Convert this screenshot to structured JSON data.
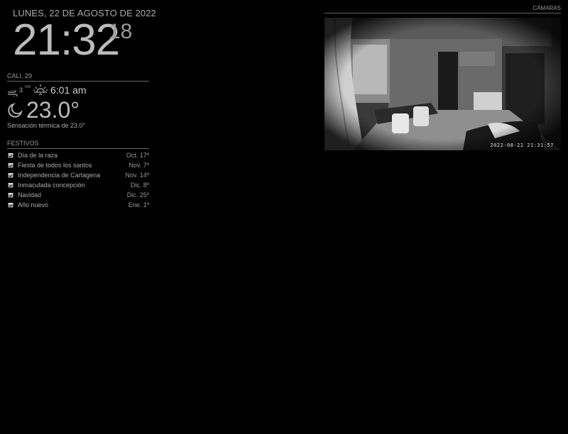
{
  "clock": {
    "date": "LUNES, 22 DE AGOSTO DE 2022",
    "hour_minute": "21:32",
    "seconds": "18"
  },
  "weather": {
    "header": "CALI, 29",
    "wind_speed": "3",
    "wind_direction": "NW",
    "sunrise": "6:01 am",
    "temperature": "23.0°",
    "feels_like": "Sensación térmica de 23.0°",
    "icons": {
      "wind": "wind-icon",
      "sunrise": "sunrise-icon",
      "condition": "moon-icon"
    }
  },
  "holidays": {
    "header": "FESTIVOS",
    "items": [
      {
        "title": "Día de la raza",
        "when": "Oct. 17º"
      },
      {
        "title": "Fiesta de todos los santos",
        "when": "Nov. 7º"
      },
      {
        "title": "Independencia de Cartagena",
        "when": "Nov. 14º"
      },
      {
        "title": "Inmaculada concepción",
        "when": "Dic. 8º"
      },
      {
        "title": "Navidad",
        "when": "Dic. 25º"
      },
      {
        "title": "Año nuevo",
        "when": "Ene. 1º"
      }
    ]
  },
  "camera": {
    "header": "CÁMARAS",
    "timestamp": "2022-08-22  21:31:57"
  },
  "colors": {
    "background": "#000000",
    "text": "#999999",
    "bright_text": "#bbbbbb",
    "divider": "#666666"
  }
}
